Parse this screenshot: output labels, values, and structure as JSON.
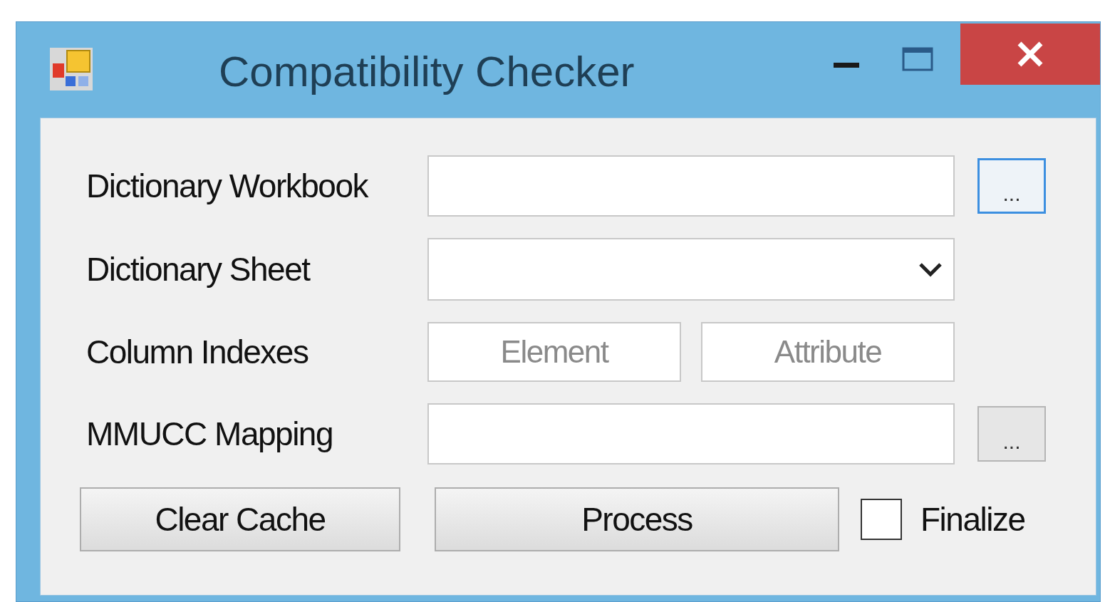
{
  "window": {
    "title": "Compatibility Checker"
  },
  "rows": [
    {
      "kind": "text",
      "label": "Dictionary Workbook",
      "browse": {
        "label": "...",
        "focused": true
      }
    },
    {
      "kind": "dropdown",
      "label": "Dictionary Sheet"
    },
    {
      "kind": "pair",
      "label": "Column Indexes",
      "fields": [
        {
          "placeholder": "Element"
        },
        {
          "placeholder": "Attribute"
        }
      ]
    },
    {
      "kind": "text",
      "label": "MMUCC Mapping",
      "browse": {
        "label": "...",
        "focused": false
      }
    }
  ],
  "buttons": [
    {
      "label": "Clear Cache"
    },
    {
      "label": "Process"
    }
  ],
  "finalize": {
    "label": "Finalize",
    "checked": false
  }
}
